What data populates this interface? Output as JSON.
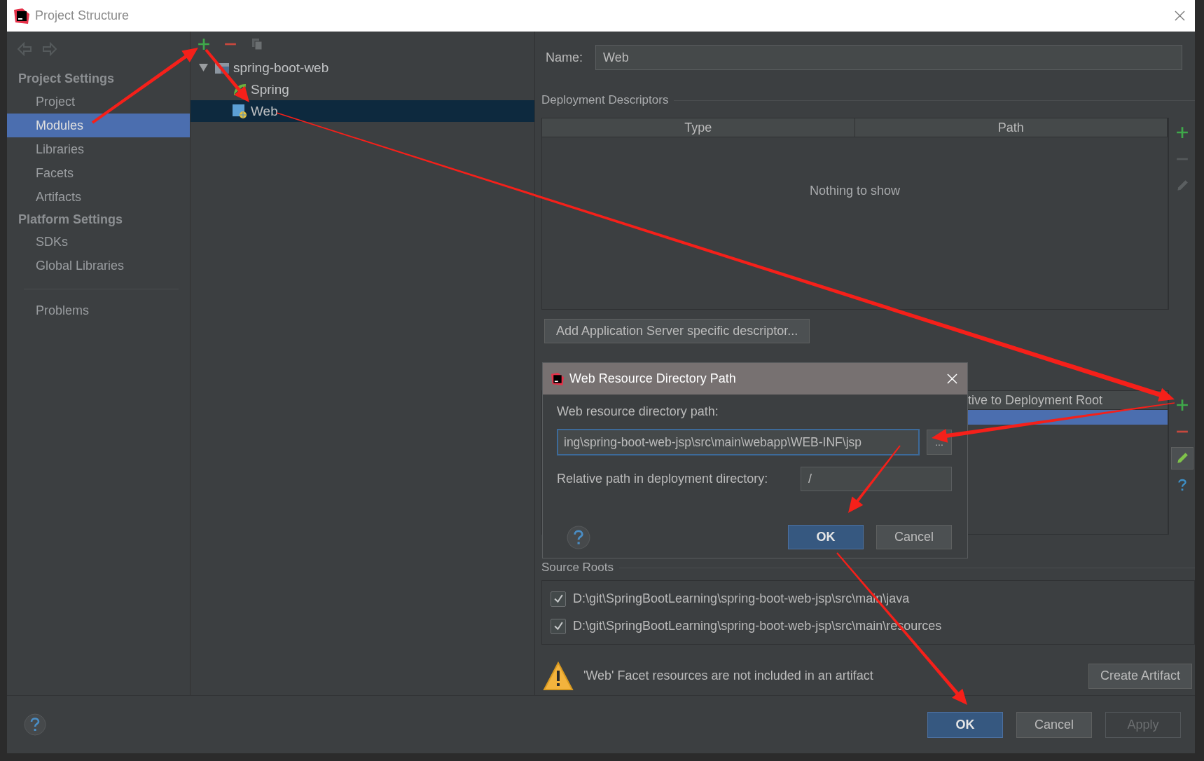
{
  "window": {
    "title": "Project Structure"
  },
  "sidebar": {
    "sections": [
      {
        "title": "Project Settings",
        "items": [
          {
            "label": "Project",
            "selected": false
          },
          {
            "label": "Modules",
            "selected": true
          },
          {
            "label": "Libraries",
            "selected": false
          },
          {
            "label": "Facets",
            "selected": false
          },
          {
            "label": "Artifacts",
            "selected": false
          }
        ]
      },
      {
        "title": "Platform Settings",
        "items": [
          {
            "label": "SDKs",
            "selected": false
          },
          {
            "label": "Global Libraries",
            "selected": false
          }
        ]
      }
    ],
    "footer_items": [
      {
        "label": "Problems",
        "selected": false
      }
    ]
  },
  "tree": {
    "items": [
      {
        "label": "spring-boot-web",
        "kind": "module",
        "expanded": true,
        "selected": false,
        "children": [
          {
            "label": "Spring",
            "kind": "spring",
            "selected": false
          },
          {
            "label": "Web",
            "kind": "web",
            "selected": true
          }
        ]
      }
    ]
  },
  "facet": {
    "name_label": "Name:",
    "name": "Web",
    "deployment_descriptors": {
      "title": "Deployment Descriptors",
      "columns": [
        "Type",
        "Path"
      ],
      "empty_text": "Nothing to show",
      "add_button": "Add Application Server specific descriptor..."
    },
    "web_resource_directories": {
      "column_2": "tive to Deployment Root"
    },
    "source_roots": {
      "title": "Source Roots",
      "items": [
        {
          "path": "D:\\git\\SpringBootLearning\\spring-boot-web-jsp\\src\\main\\java",
          "checked": true
        },
        {
          "path": "D:\\git\\SpringBootLearning\\spring-boot-web-jsp\\src\\main\\resources",
          "checked": true
        }
      ]
    },
    "warning": "'Web' Facet resources are not included in an artifact",
    "create_artifact": "Create Artifact"
  },
  "buttons": [
    {
      "label": "OK",
      "default": true,
      "disabled": false
    },
    {
      "label": "Cancel",
      "default": false,
      "disabled": false
    },
    {
      "label": "Apply",
      "default": false,
      "disabled": true
    }
  ],
  "dialog": {
    "title": "Web Resource Directory Path",
    "path_label": "Web resource directory path:",
    "path_value": "ing\\spring-boot-web-jsp\\src\\main\\webapp\\WEB-INF\\jsp",
    "browse": "...",
    "relative_label": "Relative path in deployment directory:",
    "relative_value": "/",
    "buttons": [
      {
        "label": "OK",
        "default": true,
        "disabled": false
      },
      {
        "label": "Cancel",
        "default": false,
        "disabled": false
      }
    ]
  }
}
